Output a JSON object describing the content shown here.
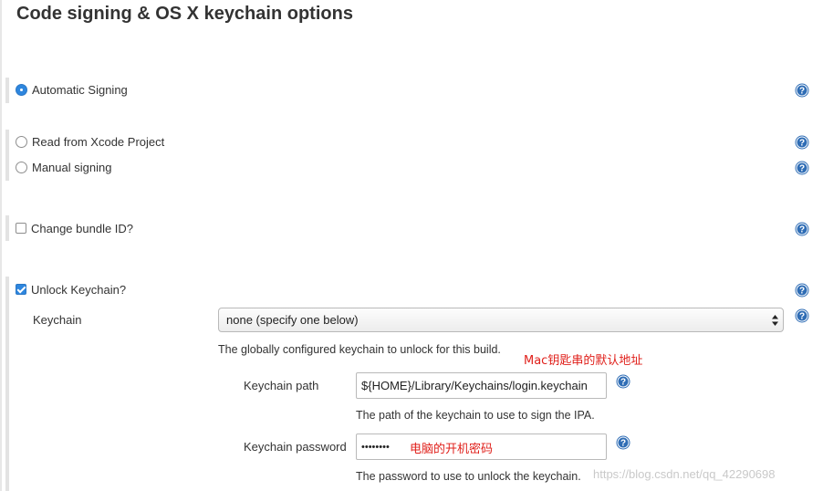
{
  "section": {
    "title": "Code signing & OS X keychain options"
  },
  "signing": {
    "automatic_label": "Automatic Signing",
    "automatic_selected": true,
    "xcode_label": "Read from Xcode Project",
    "xcode_selected": false,
    "manual_label": "Manual signing",
    "manual_selected": false
  },
  "bundle": {
    "change_label": "Change bundle ID?",
    "checked": false
  },
  "keychain": {
    "unlock_label": "Unlock Keychain?",
    "unlock_checked": true,
    "keychain_label": "Keychain",
    "keychain_selected": "none (specify one below)",
    "keychain_desc": "The globally configured keychain to unlock for this build.",
    "path_label": "Keychain path",
    "path_value": "${HOME}/Library/Keychains/login.keychain",
    "path_desc": "The path of the keychain to use to sign the IPA.",
    "password_label": "Keychain password",
    "password_value": "••••••••",
    "password_desc": "The password to use to unlock the keychain."
  },
  "annotations": {
    "keychain_default_path": "Mac钥匙串的默认地址",
    "computer_password": "电脑的开机密码"
  },
  "watermark": "https://blog.csdn.net/qq_42290698",
  "colors": {
    "accent": "#2e86de",
    "help_icon": "#2f6db5",
    "annotation": "#e0201b"
  }
}
